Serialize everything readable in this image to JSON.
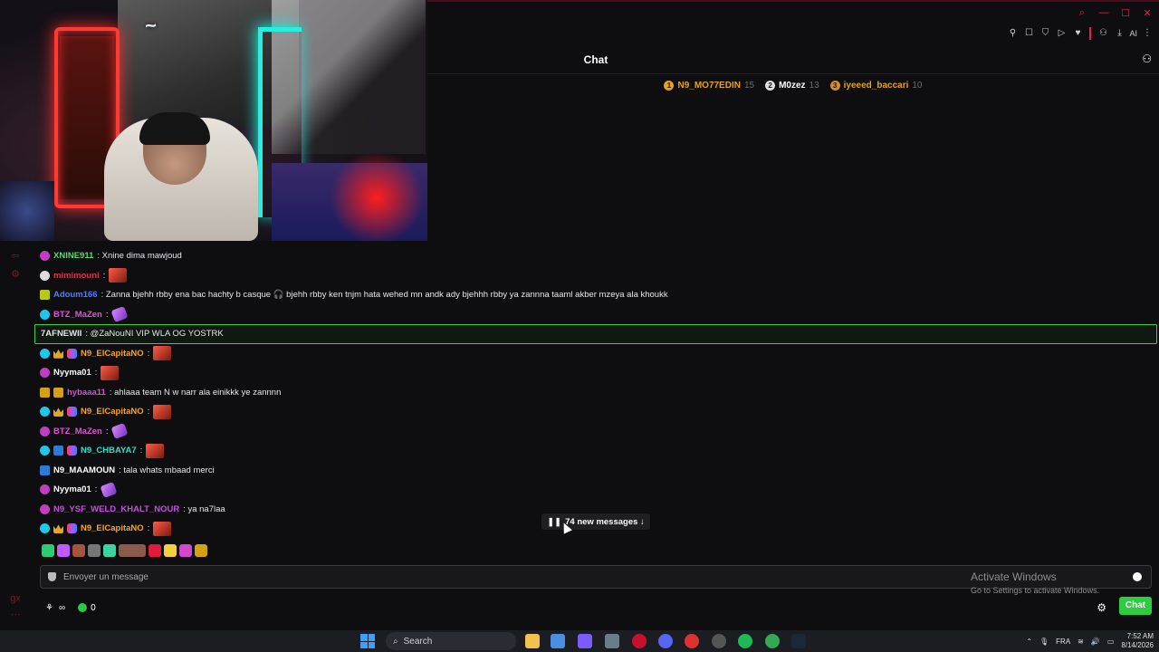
{
  "window": {
    "controls": [
      "search",
      "minimize",
      "maximize",
      "close"
    ]
  },
  "toolbar": {
    "ai_label": "AI"
  },
  "chat": {
    "title": "Chat",
    "leaderboard": [
      {
        "rank": "1",
        "name": "N9_MO77EDIN",
        "count": "15",
        "color": "#e6a317",
        "name_color": "#e6a317"
      },
      {
        "rank": "2",
        "name": "M0zez",
        "count": "13",
        "color": "#dddddd",
        "name_color": "#ffffff"
      },
      {
        "rank": "3",
        "name": "iyeeed_baccari",
        "count": "10",
        "color": "#d9892b",
        "name_color": "#e6a317"
      }
    ],
    "messages": [
      {
        "user": "XNINE911",
        "color": "#5bd86f",
        "text": ": Xnine dima mawjoud",
        "emotes": 0
      },
      {
        "user": "mimimouni",
        "color": "#d6334f",
        "text": ":",
        "emotes": 1
      },
      {
        "user": "Adoum166",
        "color": "#4d7ef7",
        "text": ": Zanna bjehh rbby ena bac hachty b casque 🎧 bjehh rbby ken tnjm hata wehed mn andk ady bjehhh rbby ya zannna taaml akber mzeya ala khoukk",
        "emotes": 0
      },
      {
        "user": "BTZ_MaZen",
        "color": "#e04fd6",
        "text": ":",
        "emotes": 1
      },
      {
        "user": "7AFNEWII",
        "color": "#e6e6ea",
        "text": ": @ZaNouNI VIP WLA OG YOSTRK",
        "emotes": 0
      },
      {
        "user": "N9_ElCapitaNO",
        "color": "#f5a623",
        "text": ":",
        "emotes": 1
      },
      {
        "user": "Nyyma01",
        "color": "#ffffff",
        "text": ":",
        "emotes": 1
      },
      {
        "user": "hybaaa11",
        "color": "#d84fd6",
        "text": ": ahlaaa team N w narr ala einikkk ye zannnn",
        "emotes": 0
      },
      {
        "user": "N9_ElCapitaNO",
        "color": "#f5a623",
        "text": ":",
        "emotes": 1
      },
      {
        "user": "BTZ_MaZen",
        "color": "#e04fd6",
        "text": ":",
        "emotes": 1
      },
      {
        "user": "N9_CHBAYA7",
        "color": "#2ee1c9",
        "text": ":",
        "emotes": 1
      },
      {
        "user": "N9_MAAMOUN",
        "color": "#ffffff",
        "text": ": tala whats mbaad merci",
        "emotes": 0
      },
      {
        "user": "Nyyma01",
        "color": "#ffffff",
        "text": ":",
        "emotes": 1
      },
      {
        "user": "N9_YSF_WELD_KHALT_NOUR",
        "color": "#c64fe0",
        "text": ": ya na7laa",
        "emotes": 0
      },
      {
        "user": "N9_ElCapitaNO",
        "color": "#f5a623",
        "text": ":",
        "emotes": 1
      }
    ],
    "new_messages": "74 new messages ↓",
    "input_placeholder": "Envoyer un message",
    "points": "0",
    "send_button": "Chat"
  },
  "watermark": {
    "line1": "Activate Windows",
    "line2": "Go to Settings to activate Windows."
  },
  "taskbar": {
    "search_label": "Search",
    "language": "FRA",
    "time": "7:52 AM",
    "date": "8/14/2026"
  }
}
